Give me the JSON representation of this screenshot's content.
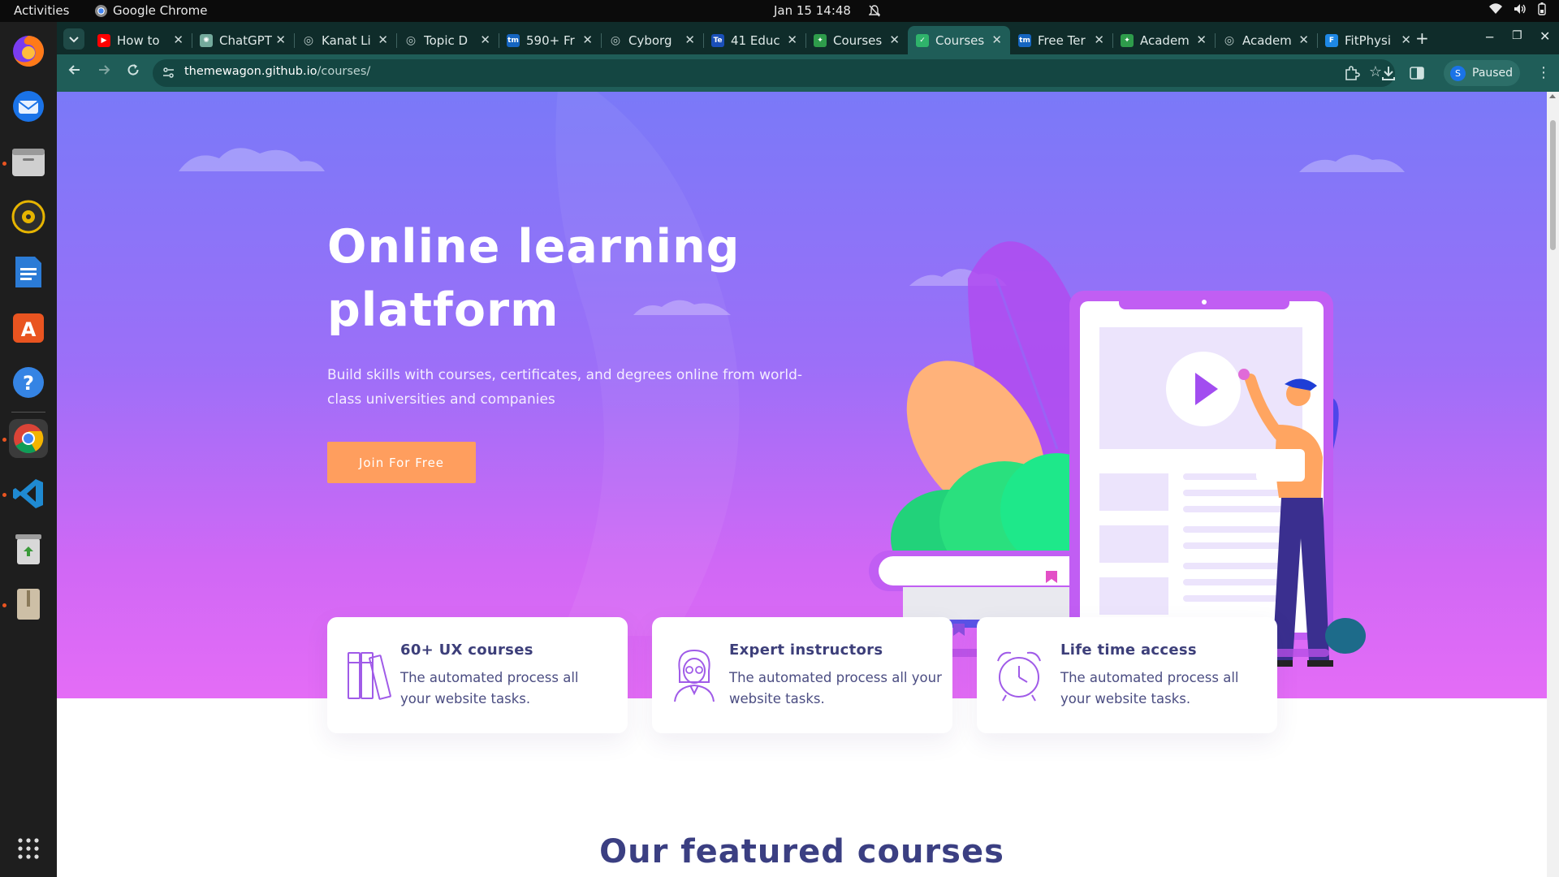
{
  "system": {
    "activities": "Activities",
    "app_name": "Google Chrome",
    "clock": "Jan 15  14:48"
  },
  "dock": {
    "items": [
      "firefox",
      "thunderbird",
      "files",
      "rhythmbox",
      "libreoffice-writer",
      "app-center",
      "help",
      "chrome",
      "vscode",
      "trash",
      "archive"
    ]
  },
  "browser": {
    "tabs": [
      {
        "title": "How to",
        "favicon": "youtube",
        "color": "#ff0000"
      },
      {
        "title": "ChatGPT",
        "favicon": "chatgpt",
        "color": "#74aa9c"
      },
      {
        "title": "Kanat Li",
        "favicon": "globe",
        "color": "#777777"
      },
      {
        "title": "Topic D",
        "favicon": "globe",
        "color": "#777777"
      },
      {
        "title": "590+ Fr",
        "favicon": "tm",
        "color": "#1565c0"
      },
      {
        "title": "Cyborg",
        "favicon": "globe",
        "color": "#777777"
      },
      {
        "title": "41 Educ",
        "favicon": "te",
        "color": "#1a4fb8"
      },
      {
        "title": "Courses",
        "favicon": "leaf",
        "color": "#2e9c4b"
      },
      {
        "title": "Courses",
        "favicon": "check",
        "color": "#2fb36b"
      },
      {
        "title": "Free Ter",
        "favicon": "tm",
        "color": "#1565c0"
      },
      {
        "title": "Academ",
        "favicon": "leaf",
        "color": "#2e9c4b"
      },
      {
        "title": "Academ",
        "favicon": "globe",
        "color": "#777777"
      },
      {
        "title": "FitPhysi",
        "favicon": "fp",
        "color": "#1e88e5"
      }
    ],
    "active_tab_index": 8,
    "new_tab": "+",
    "url_host": "themewagon.github.io",
    "url_path": "/courses/",
    "profile_initial": "S",
    "profile_label": "Paused"
  },
  "page": {
    "hero": {
      "title": "Online learning platform",
      "subtitle": "Build skills with courses, certificates, and degrees online from world-class universities and companies",
      "cta": "Join For Free"
    },
    "features": [
      {
        "icon": "books-icon",
        "title": "60+ UX courses",
        "text": "The automated process all your website tasks."
      },
      {
        "icon": "instructor-icon",
        "title": "Expert instructors",
        "text": "The automated process all your website tasks."
      },
      {
        "icon": "alarm-clock-icon",
        "title": "Life time access",
        "text": "The automated process all your website tasks."
      }
    ],
    "featured_title": "Our featured courses"
  },
  "colors": {
    "hero_top": "#7a79f8",
    "hero_bottom": "#e46cf6",
    "cta": "#ff9e5e",
    "heading": "#3d3f7a",
    "chrome_frame": "#0f2c2a",
    "chrome_toolbar": "#1f5d58"
  }
}
